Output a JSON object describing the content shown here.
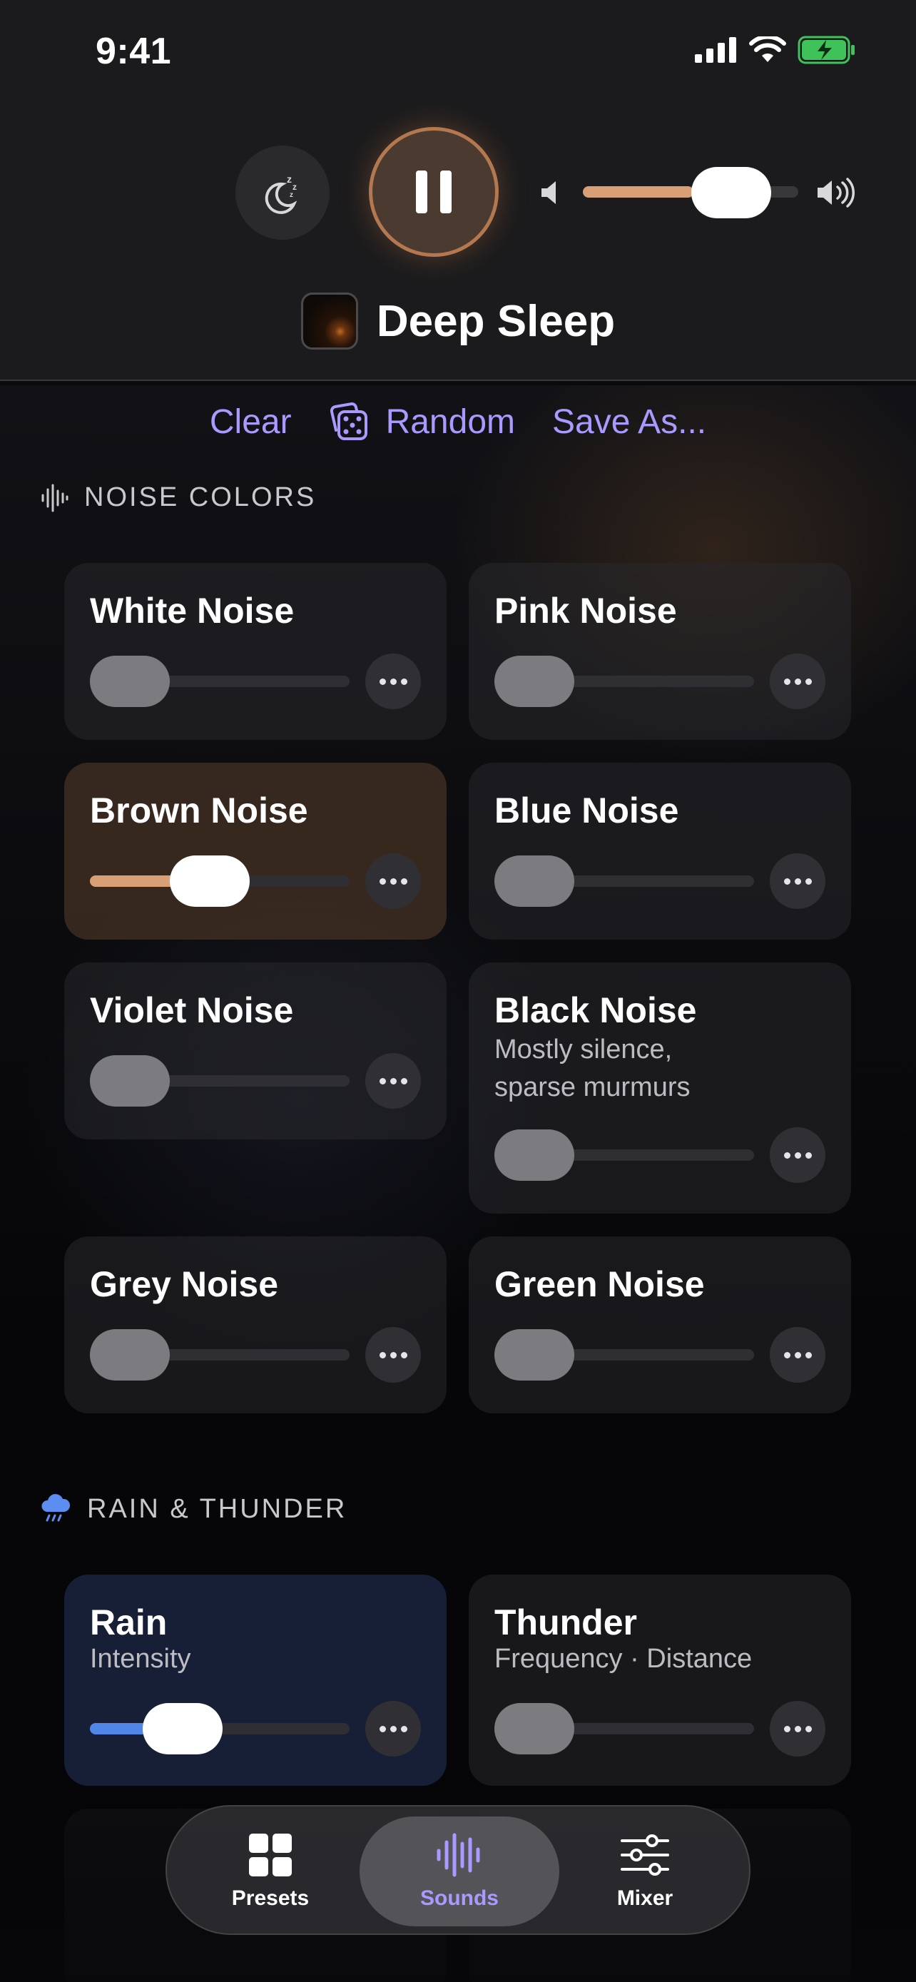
{
  "status_bar": {
    "time": "9:41"
  },
  "player": {
    "title": "Deep Sleep",
    "volume_fraction": 0.58,
    "state": "playing"
  },
  "actions": {
    "clear": "Clear",
    "random": "Random",
    "save_as": "Save As..."
  },
  "sections": [
    {
      "title": "NOISE COLORS",
      "icon": "waveform-icon",
      "items": [
        {
          "name": "White Noise",
          "subtitle": "",
          "level": 0.0
        },
        {
          "name": "Pink Noise",
          "subtitle": "",
          "level": 0.0
        },
        {
          "name": "Brown Noise",
          "subtitle": "",
          "level": 0.36,
          "accent": "#d9a075"
        },
        {
          "name": "Blue Noise",
          "subtitle": "",
          "level": 0.0
        },
        {
          "name": "Violet Noise",
          "subtitle": "",
          "level": 0.0
        },
        {
          "name": "Black Noise",
          "subtitle_lines": [
            "Mostly silence,",
            "sparse murmurs"
          ],
          "level": 0.0
        },
        {
          "name": "Grey Noise",
          "subtitle": "",
          "level": 0.0
        },
        {
          "name": "Green Noise",
          "subtitle": "",
          "level": 0.0
        }
      ]
    },
    {
      "title": "RAIN & THUNDER",
      "icon": "rain-cloud-icon",
      "items": [
        {
          "name": "Rain",
          "subtitle": "Intensity",
          "level": 0.24,
          "accent": "#4f86e8"
        },
        {
          "name": "Thunder",
          "subtitle": "Frequency · Distance",
          "level": 0.0
        }
      ]
    }
  ],
  "tabs": [
    {
      "label": "Presets",
      "icon": "grid-icon"
    },
    {
      "label": "Sounds",
      "icon": "waveform-icon",
      "active": true
    },
    {
      "label": "Mixer",
      "icon": "sliders-icon"
    }
  ],
  "colors": {
    "accent": "#a99aff",
    "brown_accent": "#d9a075",
    "rain_accent": "#4f86e8"
  }
}
